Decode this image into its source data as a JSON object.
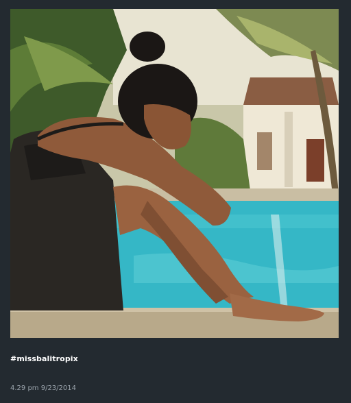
{
  "post": {
    "hashtag": "#missbalitropix",
    "timestamp": "4.29 pm 9/23/2014"
  },
  "photo": {
    "icon": "poolside-photo"
  },
  "colors": {
    "background": "#232a30",
    "hashtag_text": "#ffffff",
    "timestamp_text": "#9aa3ab",
    "pool_water": "#35b7c6"
  }
}
